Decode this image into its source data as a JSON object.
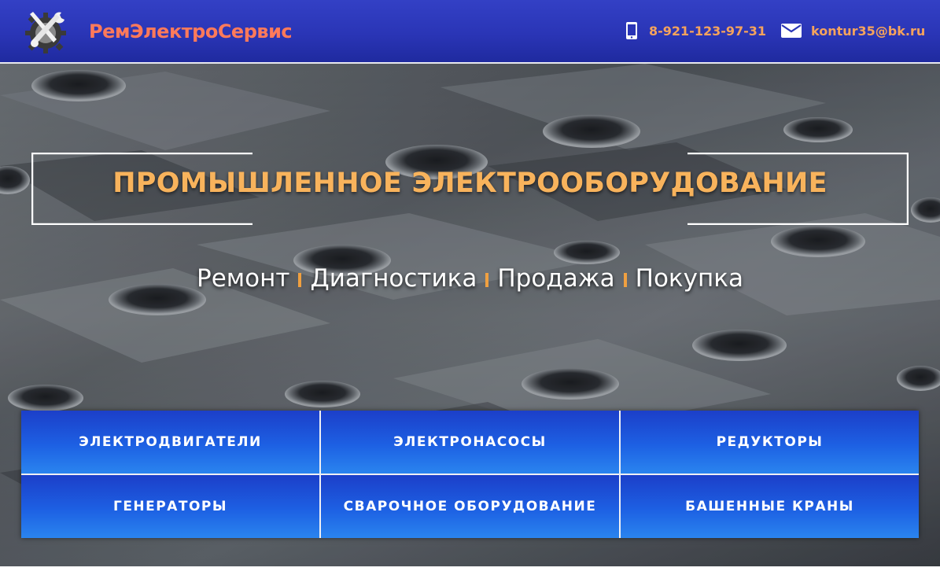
{
  "header": {
    "brand": "РемЭлектроСервис",
    "phone": "8-921-123-97-31",
    "email": "kontur35@bk.ru",
    "icons": {
      "logo": "gear-wrench-screwdriver-logo",
      "phone": "phone-icon",
      "email": "envelope-icon"
    }
  },
  "hero": {
    "title": "ПРОМЫШЛЕННОЕ ЭЛЕКТРООБОРУДОВАНИЕ",
    "services": [
      "Ремонт",
      "Диагностика",
      "Продажа",
      "Покупка"
    ]
  },
  "categories": [
    "ЭЛЕКТРОДВИГАТЕЛИ",
    "ЭЛЕКТРОНАСОСЫ",
    "РЕДУКТОРЫ",
    "ГЕНЕРАТОРЫ",
    "СВАРОЧНОЕ ОБОРУДОВАНИЕ",
    "БАШЕННЫЕ КРАНЫ"
  ],
  "colors": {
    "header_bg": "#2a35b6",
    "brand": "#ff7a5a",
    "contact": "#f5a35c",
    "title": "#f8b35c",
    "separator": "#f0a040",
    "tile_bg": "#1d60e3"
  }
}
